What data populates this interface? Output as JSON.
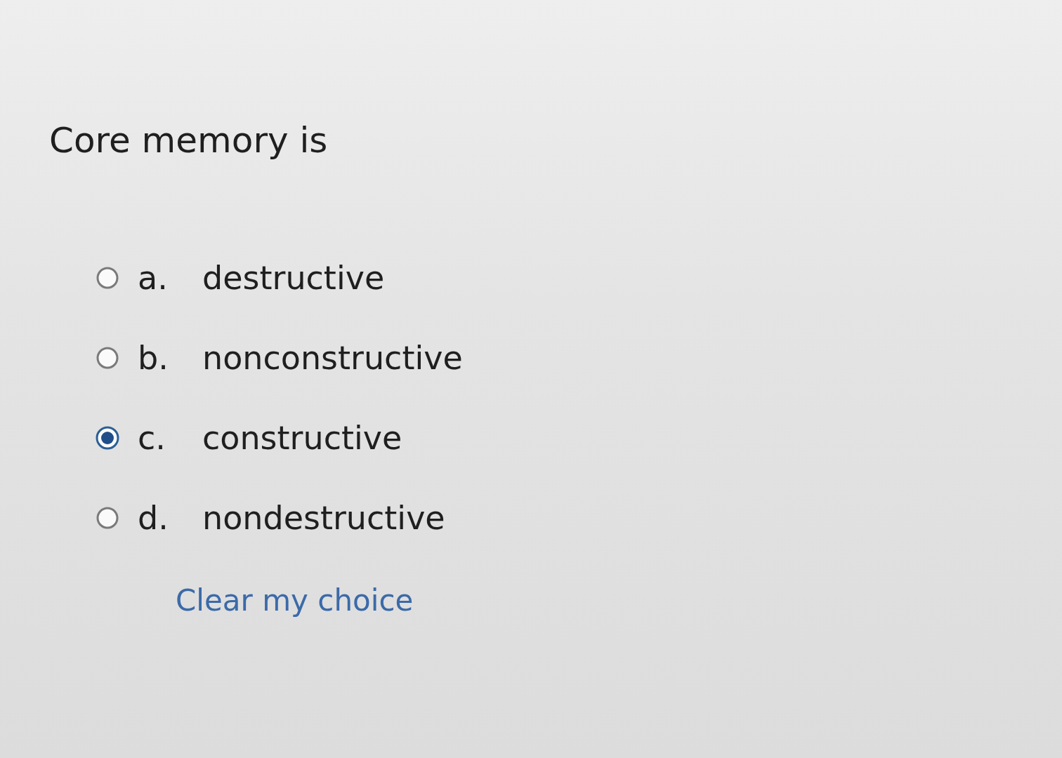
{
  "question": {
    "text": "Core memory is"
  },
  "options": [
    {
      "letter": "a.",
      "label": "destructive",
      "selected": false
    },
    {
      "letter": "b.",
      "label": "nonconstructive",
      "selected": false
    },
    {
      "letter": "c.",
      "label": "constructive",
      "selected": true
    },
    {
      "letter": "d.",
      "label": "nondestructive",
      "selected": false
    }
  ],
  "clear_link": "Clear my choice"
}
